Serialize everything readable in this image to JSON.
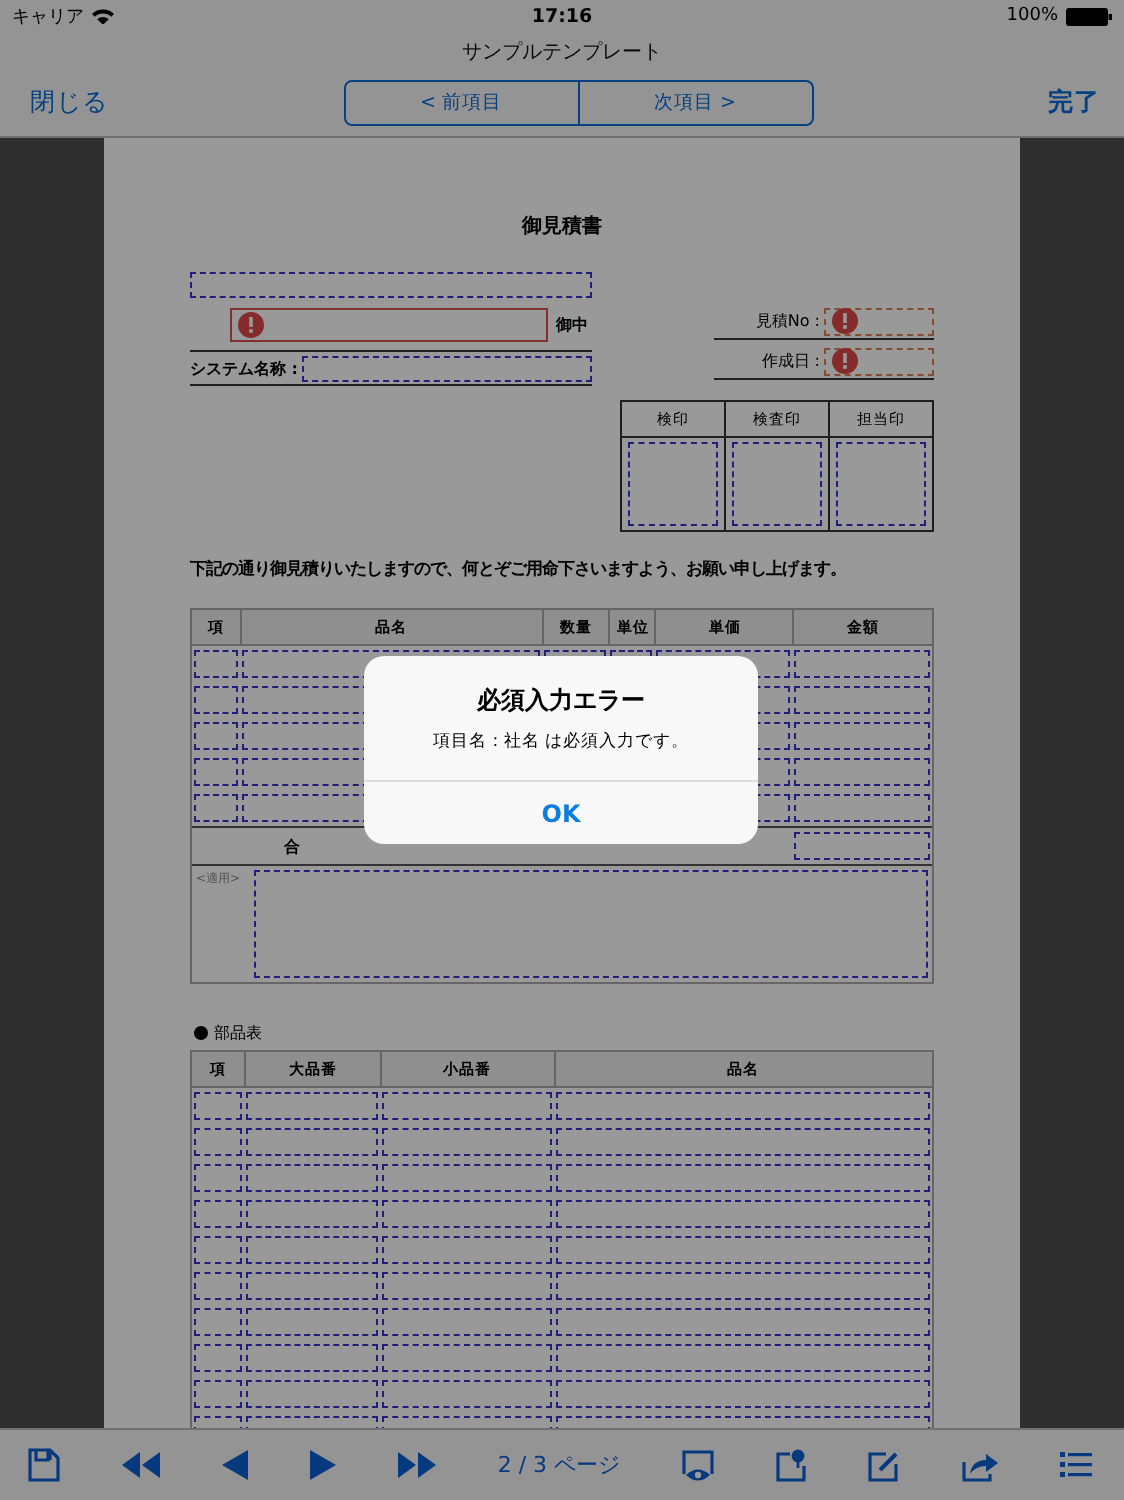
{
  "status_bar": {
    "carrier": "キャリア",
    "time": "17:16",
    "battery": "100%"
  },
  "nav": {
    "title": "サンプルテンプレート",
    "close": "閉じる",
    "prev": "< 前項目",
    "next": "次項目 >",
    "done": "完了"
  },
  "document": {
    "title": "御見積書",
    "company_field": {
      "error": true,
      "suffix": "御中"
    },
    "system_name_label": "システム名称 :",
    "estimate_fields": [
      {
        "label": "見積No :",
        "error": true
      },
      {
        "label": "作成日 :",
        "error": true
      }
    ],
    "stamps": [
      "検印",
      "検査印",
      "担当印"
    ],
    "message": "下記の通り御見積りいたしますので、何とぞご用命下さいますよう、お願い申し上げます。",
    "items_table": {
      "columns": [
        "項",
        "品名",
        "数量",
        "単位",
        "単価",
        "金額"
      ],
      "total_label": "合",
      "remarks_label": "<適用>"
    },
    "parts_title": "部品表",
    "parts_table": {
      "columns": [
        "項",
        "大品番",
        "小品番",
        "品名"
      ]
    }
  },
  "toolbar": {
    "page_label": "2 / 3 ページ"
  },
  "alert": {
    "title": "必須入力エラー",
    "message": "項目名 : 社名 は必須入力です。",
    "button": "OK"
  }
}
